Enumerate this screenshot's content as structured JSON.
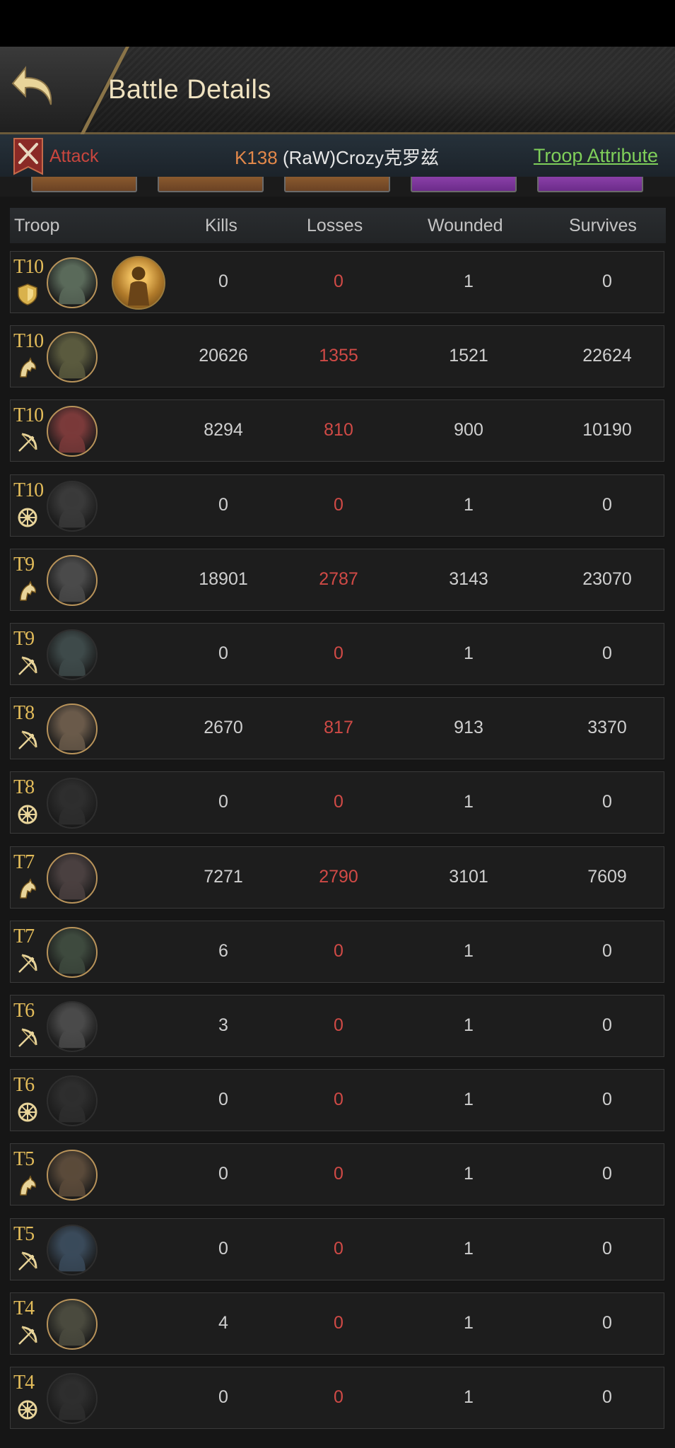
{
  "header": {
    "title": "Battle Details"
  },
  "attack_bar": {
    "label": "Attack",
    "kingdom": "K138",
    "player": "(RaW)Crozy克罗兹",
    "link": "Troop Attribute"
  },
  "columns": {
    "troop": "Troop",
    "kills": "Kills",
    "losses": "Losses",
    "wounded": "Wounded",
    "survives": "Survives"
  },
  "rows": [
    {
      "tier": "T10",
      "type": "shield-icon",
      "kills": "0",
      "losses": "0",
      "wounded": "1",
      "survives": "0"
    },
    {
      "tier": "T10",
      "type": "cavalry-icon",
      "kills": "20626",
      "losses": "1355",
      "wounded": "1521",
      "survives": "22624"
    },
    {
      "tier": "T10",
      "type": "archer-icon",
      "kills": "8294",
      "losses": "810",
      "wounded": "900",
      "survives": "10190"
    },
    {
      "tier": "T10",
      "type": "siege-icon",
      "kills": "0",
      "losses": "0",
      "wounded": "1",
      "survives": "0"
    },
    {
      "tier": "T9",
      "type": "cavalry-icon",
      "kills": "18901",
      "losses": "2787",
      "wounded": "3143",
      "survives": "23070"
    },
    {
      "tier": "T9",
      "type": "archer-icon",
      "kills": "0",
      "losses": "0",
      "wounded": "1",
      "survives": "0"
    },
    {
      "tier": "T8",
      "type": "archer-icon",
      "kills": "2670",
      "losses": "817",
      "wounded": "913",
      "survives": "3370"
    },
    {
      "tier": "T8",
      "type": "siege-icon",
      "kills": "0",
      "losses": "0",
      "wounded": "1",
      "survives": "0"
    },
    {
      "tier": "T7",
      "type": "cavalry-icon",
      "kills": "7271",
      "losses": "2790",
      "wounded": "3101",
      "survives": "7609"
    },
    {
      "tier": "T7",
      "type": "archer-icon",
      "kills": "6",
      "losses": "0",
      "wounded": "1",
      "survives": "0"
    },
    {
      "tier": "T6",
      "type": "archer-icon",
      "kills": "3",
      "losses": "0",
      "wounded": "1",
      "survives": "0"
    },
    {
      "tier": "T6",
      "type": "siege-icon",
      "kills": "0",
      "losses": "0",
      "wounded": "1",
      "survives": "0"
    },
    {
      "tier": "T5",
      "type": "cavalry-icon",
      "kills": "0",
      "losses": "0",
      "wounded": "1",
      "survives": "0"
    },
    {
      "tier": "T5",
      "type": "archer-icon",
      "kills": "0",
      "losses": "0",
      "wounded": "1",
      "survives": "0"
    },
    {
      "tier": "T4",
      "type": "archer-icon",
      "kills": "4",
      "losses": "0",
      "wounded": "1",
      "survives": "0"
    },
    {
      "tier": "T4",
      "type": "siege-icon",
      "kills": "0",
      "losses": "0",
      "wounded": "1",
      "survives": "0"
    }
  ],
  "colors": {
    "accent_gold": "#e3bc5a",
    "loss_red": "#d04a46",
    "link_green": "#7fcf5a",
    "kingdom_orange": "#e2884a"
  }
}
